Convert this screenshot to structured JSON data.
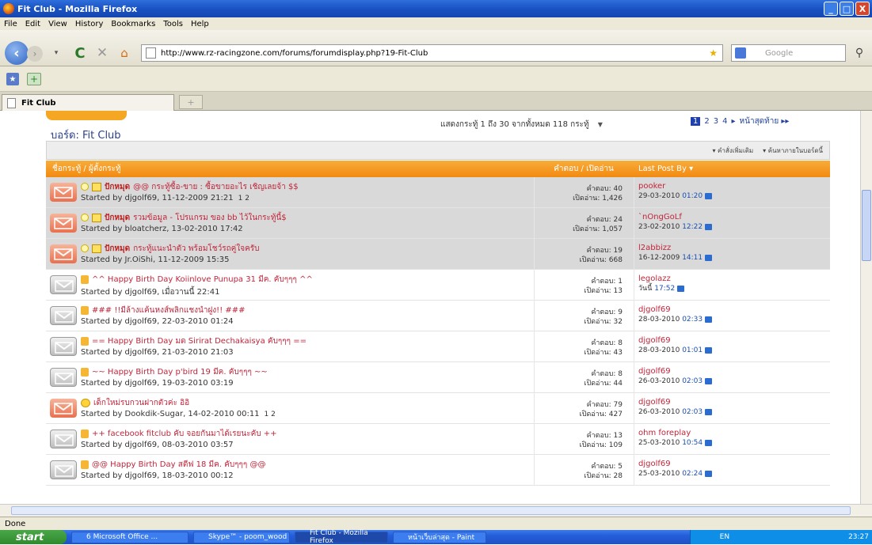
{
  "window": {
    "title": "Fit Club - Mozilla Firefox",
    "min": "_",
    "max": "□",
    "close": "X"
  },
  "menu": [
    "File",
    "Edit",
    "View",
    "History",
    "Bookmarks",
    "Tools",
    "Help"
  ],
  "nav": {
    "url": "http://www.rz-racingzone.com/forums/forumdisplay.php?19-Fit-Club",
    "search_placeholder": "Google"
  },
  "tab": {
    "label": "Fit Club",
    "new_tab": "+"
  },
  "forum": {
    "title": "บอร์ด: Fit Club",
    "showing": "แสดงกระทู้ 1 ถึง 30 จากทั้งหมด 118 กระทู้",
    "pages": [
      "1",
      "2",
      "3",
      "4"
    ],
    "next": "▸",
    "last": "หน้าสุดท้าย ▸▸",
    "tools": [
      "▾ คำสั่งเพิ่มเติม",
      "▾ ค้นหาภายในบอร์ดนี้"
    ],
    "headers": {
      "thread": "ชื่อกระทู้ / ผู้ตั้งกระทู้",
      "stats": "คำตอบ / เปิดอ่าน",
      "last": "Last Post By ▾"
    }
  },
  "threads": [
    {
      "sticky": true,
      "prefix": "ปักหมุด",
      "title": "@@ กระทู้ซื้อ-ขาย : ซื้อขายอะไร เชิญเลยจ้า $$",
      "by": "Started by djgolf69, 11-12-2009 21:21",
      "pages": "1  2",
      "replies": "คำตอบ: 40",
      "views": "เปิดอ่าน: 1,426",
      "last_user": "pooker",
      "last_date": "29-03-2010",
      "last_time": "01:20",
      "env": "orange",
      "green": false
    },
    {
      "sticky": true,
      "prefix": "ปักหมุด",
      "title": "รวมข้อมูล - โปรแกรม ของ bb ไว้ในกระทู้นี้$",
      "by": "Started by bloatcherz, 13-02-2010 17:42",
      "pages": "",
      "replies": "คำตอบ: 24",
      "views": "เปิดอ่าน: 1,057",
      "last_user": "`nOngGoLf",
      "last_date": "23-02-2010",
      "last_time": "12:22",
      "env": "orange",
      "green": false
    },
    {
      "sticky": true,
      "prefix": "ปักหมุด",
      "title": "กระทู้แนะนำตัว พร้อมโชว์รถคู่ใจครับ",
      "by": "Started by Jr.OiShi, 11-12-2009 15:35",
      "pages": "",
      "replies": "คำตอบ: 19",
      "views": "เปิดอ่าน: 668",
      "last_user": "l2abbizz",
      "last_date": "16-12-2009",
      "last_time": "14:11",
      "env": "orange",
      "green": false
    },
    {
      "sticky": false,
      "prefix": "",
      "title": "^^ Happy Birth Day Koiinlove Punupa 31 มีค. คับๆๆๆ ^^",
      "by": "Started by djgolf69, เมื่อวานนี้ 22:41",
      "pages": "",
      "replies": "คำตอบ: 1",
      "views": "เปิดอ่าน: 13",
      "last_user": "legolazz",
      "last_date": "วันนี้",
      "last_time": "17:52",
      "env": "gray",
      "green": false
    },
    {
      "sticky": false,
      "prefix": "",
      "title": "### !!มีล้างแค้นหงส์พลิกแชงนำฝูง!! ###",
      "by": "Started by djgolf69, 22-03-2010 01:24",
      "pages": "",
      "replies": "คำตอบ: 9",
      "views": "เปิดอ่าน: 32",
      "last_user": "djgolf69",
      "last_date": "28-03-2010",
      "last_time": "02:33",
      "env": "gray",
      "green": false
    },
    {
      "sticky": false,
      "prefix": "",
      "title": "== Happy Birth Day มด Sirirat Dechakaisya คับๆๆๆ ==",
      "by": "Started by djgolf69, 21-03-2010 21:03",
      "pages": "",
      "replies": "คำตอบ: 8",
      "views": "เปิดอ่าน: 43",
      "last_user": "djgolf69",
      "last_date": "28-03-2010",
      "last_time": "01:01",
      "env": "gray",
      "green": false
    },
    {
      "sticky": false,
      "prefix": "",
      "title": "~~ Happy Birth Day p'bird 19 มีค. คับๆๆๆ ~~",
      "by": "Started by djgolf69, 19-03-2010 03:19",
      "pages": "",
      "replies": "คำตอบ: 8",
      "views": "เปิดอ่าน: 44",
      "last_user": "djgolf69",
      "last_date": "26-03-2010",
      "last_time": "02:03",
      "env": "gray",
      "green": false
    },
    {
      "sticky": false,
      "prefix": "",
      "title": "เด็กใหม่รบกวนฝากตัวค่ะ อิอิ",
      "by": "Started by Dookdik-Sugar, 14-02-2010 00:11",
      "pages": "1  2",
      "replies": "คำตอบ: 79",
      "views": "เปิดอ่าน: 427",
      "last_user": "djgolf69",
      "last_date": "26-03-2010",
      "last_time": "02:03",
      "env": "orange",
      "green": false
    },
    {
      "sticky": false,
      "prefix": "",
      "title": "++ facebook fitclub คับ จอยกันมาได้เรยนะคับ ++",
      "by": "Started by djgolf69, 08-03-2010 03:57",
      "pages": "",
      "replies": "คำตอบ: 13",
      "views": "เปิดอ่าน: 109",
      "last_user": "ohm foreplay",
      "last_date": "25-03-2010",
      "last_time": "10:54",
      "env": "gray",
      "green": false
    },
    {
      "sticky": false,
      "prefix": "",
      "title": "@@ Happy Birth Day สตีฟ 18 มีค. คับๆๆๆ @@",
      "by": "Started by djgolf69, 18-03-2010 00:12",
      "pages": "",
      "replies": "คำตอบ: 5",
      "views": "เปิดอ่าน: 28",
      "last_user": "djgolf69",
      "last_date": "25-03-2010",
      "last_time": "02:24",
      "env": "gray",
      "green": false
    }
  ],
  "status": "Done",
  "taskbar": {
    "start": "start",
    "tasks": [
      "6 Microsoft Office ...",
      "Skype™ - poom_wood",
      "Fit Club - Mozilla Firefox",
      "หน้าเว็บล่าสุด - Paint"
    ],
    "lang": "EN",
    "clock": "23:27"
  }
}
